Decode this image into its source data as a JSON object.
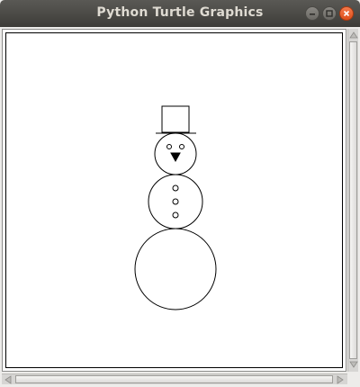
{
  "window": {
    "title": "Python Turtle Graphics"
  },
  "controls": {
    "minimize_icon": "minimize-icon",
    "maximize_icon": "maximize-icon",
    "close_icon": "close-icon"
  },
  "colors": {
    "titlebar": "#3d3c38",
    "close_button": "#de4e1a",
    "canvas_background": "#ffffff",
    "stroke": "#000000"
  },
  "canvas": {
    "drawing": "snowman"
  }
}
